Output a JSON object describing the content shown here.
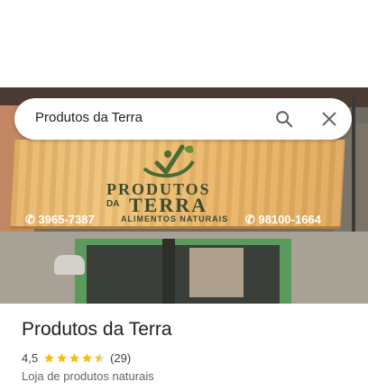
{
  "search": {
    "query": "Produtos da Terra"
  },
  "photo": {
    "sign": {
      "brand_line1": "PRODUTOS",
      "brand_da": "DA",
      "brand_line2": "TERRA",
      "tagline": "ALIMENTOS NATURAIS",
      "phone_left": "3965-7387",
      "phone_right": "98100-1664"
    }
  },
  "place": {
    "name": "Produtos da Terra",
    "rating": "4,5",
    "rating_value": 4.5,
    "reviews": "(29)",
    "category": "Loja de produtos naturais"
  },
  "colors": {
    "star": "#fbbc04",
    "star_empty": "#dadce0",
    "text_primary": "#202124",
    "text_secondary": "#5f6368"
  },
  "icons": {
    "search": "search-icon",
    "close": "close-icon",
    "star": "star-icon"
  }
}
